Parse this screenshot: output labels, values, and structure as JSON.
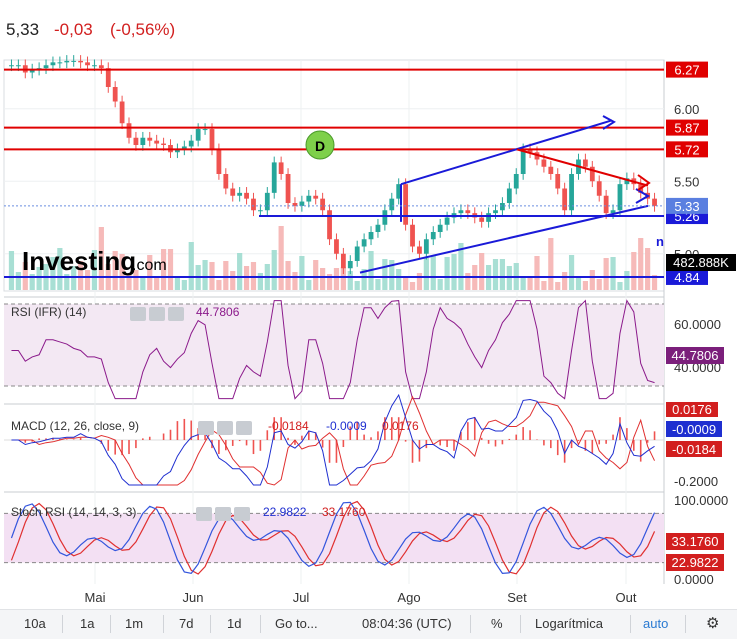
{
  "header": {
    "price": "5,33",
    "change": "-0,03",
    "change_pct": "(-0,56%)"
  },
  "brand": {
    "logo": "Investing",
    "suffix": ".com"
  },
  "colors": {
    "up": "#26a69a",
    "down": "#ef5350",
    "level": "#e00000",
    "trend": "#1a1ad8",
    "rsi": "#8b1a8b",
    "macd": "#1f2fd0",
    "signal": "#e03030",
    "stoch_k": "#3355dd",
    "stoch_d": "#e03030"
  },
  "price_axis": {
    "ticks": [
      "6.00",
      "5.50",
      "5.00"
    ],
    "levels": [
      "6.27",
      "5.87",
      "5.72",
      "5.26",
      "4.84"
    ],
    "current": "5.33",
    "volume": "482.888K",
    "partial_label": "n"
  },
  "annotation": "D",
  "time_axis": [
    "Mai",
    "Jun",
    "Jul",
    "Ago",
    "Set",
    "Out"
  ],
  "rsi": {
    "title": "RSI (IFR) (14)",
    "value": "44.7806",
    "ticks": [
      "60.0000",
      "40.0000"
    ],
    "current": "44.7806"
  },
  "macd": {
    "title": "MACD (12, 26, close, 9)",
    "v1": "-0.0184",
    "v2": "-0.0009",
    "v3": "0.0176",
    "ticks": [
      "0.0176",
      "-0.0009",
      "-0.0184",
      "-0.2000"
    ]
  },
  "stoch": {
    "title": "Stoch RSI (14, 14, 3, 3)",
    "k": "22.9822",
    "d": "33.1760",
    "ticks": [
      "100.0000",
      "33.1760",
      "22.9822",
      "0.0000"
    ]
  },
  "toolbar": {
    "ranges": [
      "10a",
      "1a",
      "1m",
      "7d",
      "1d"
    ],
    "goto": "Go to...",
    "time": "08:04:36 (UTC)",
    "pct": "%",
    "log": "Logarítmica",
    "auto": "auto"
  },
  "chart_data": {
    "type": "candlestick",
    "currency_units": "price",
    "ylim": [
      4.75,
      6.35
    ],
    "x": [
      "Mai",
      "Jun",
      "Jul",
      "Ago",
      "Set",
      "Out"
    ],
    "close": [
      6.3,
      6.3,
      6.25,
      6.27,
      6.28,
      6.3,
      6.32,
      6.32,
      6.33,
      6.33,
      6.32,
      6.3,
      6.3,
      6.28,
      6.15,
      6.05,
      5.9,
      5.8,
      5.75,
      5.8,
      5.78,
      5.76,
      5.75,
      5.7,
      5.72,
      5.74,
      5.78,
      5.86,
      5.86,
      5.72,
      5.55,
      5.45,
      5.4,
      5.42,
      5.38,
      5.3,
      5.3,
      5.42,
      5.63,
      5.55,
      5.35,
      5.33,
      5.36,
      5.4,
      5.38,
      5.3,
      5.1,
      5.0,
      4.9,
      4.95,
      5.05,
      5.1,
      5.15,
      5.2,
      5.3,
      5.38,
      5.48,
      5.2,
      5.05,
      5.0,
      5.1,
      5.15,
      5.2,
      5.25,
      5.28,
      5.3,
      5.28,
      5.25,
      5.22,
      5.28,
      5.3,
      5.35,
      5.45,
      5.55,
      5.72,
      5.7,
      5.65,
      5.6,
      5.55,
      5.45,
      5.3,
      5.55,
      5.65,
      5.6,
      5.5,
      5.4,
      5.28,
      5.3,
      5.48,
      5.52,
      5.48,
      5.42,
      5.38,
      5.33
    ],
    "levels": [
      6.27,
      5.87,
      5.72,
      5.26,
      4.84
    ],
    "volume_last": 482888,
    "rsi": {
      "last": 44.7806,
      "ylim": [
        20,
        80
      ]
    },
    "macd": {
      "macd": -0.0009,
      "signal": -0.0184,
      "hist": 0.0176
    },
    "stoch_rsi": {
      "k": 22.9822,
      "d": 33.176,
      "ylim": [
        0,
        100
      ]
    }
  }
}
